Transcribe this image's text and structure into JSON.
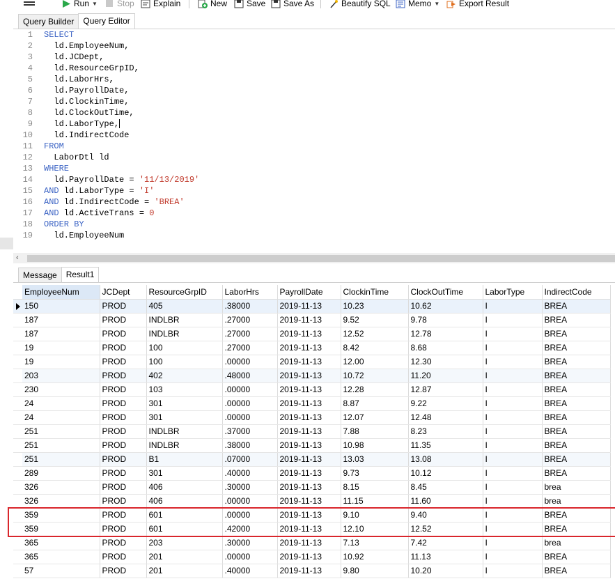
{
  "toolbar": {
    "run": "Run",
    "stop": "Stop",
    "explain": "Explain",
    "new": "New",
    "save": "Save",
    "save_as": "Save As",
    "beautify": "Beautify SQL",
    "memo": "Memo",
    "export": "Export Result"
  },
  "editor_tabs": [
    "Query Builder",
    "Query Editor"
  ],
  "sql_lines": [
    {
      "n": "1",
      "code": "SELECT"
    },
    {
      "n": "2",
      "code": "  ld.EmployeeNum,"
    },
    {
      "n": "3",
      "code": "  ld.JCDept,"
    },
    {
      "n": "4",
      "code": "  ld.ResourceGrpID,"
    },
    {
      "n": "5",
      "code": "  ld.LaborHrs,"
    },
    {
      "n": "6",
      "code": "  ld.PayrollDate,"
    },
    {
      "n": "7",
      "code": "  ld.ClockinTime,"
    },
    {
      "n": "8",
      "code": "  ld.ClockOutTime,"
    },
    {
      "n": "9",
      "code": "  ld.LaborType,"
    },
    {
      "n": "10",
      "code": "  ld.IndirectCode"
    },
    {
      "n": "11",
      "code": "FROM"
    },
    {
      "n": "12",
      "code": "  LaborDtl ld"
    },
    {
      "n": "13",
      "code": "WHERE"
    },
    {
      "n": "14",
      "code": "  ld.PayrollDate = '11/13/2019'"
    },
    {
      "n": "15",
      "code": "AND ld.LaborType = 'I'"
    },
    {
      "n": "16",
      "code": "AND ld.IndirectCode = 'BREA'"
    },
    {
      "n": "17",
      "code": "AND ld.ActiveTrans = 0"
    },
    {
      "n": "18",
      "code": "ORDER BY"
    },
    {
      "n": "19",
      "code": "  ld.EmployeeNum"
    }
  ],
  "result_tabs": [
    "Message",
    "Result1"
  ],
  "columns": [
    "EmployeeNum",
    "JCDept",
    "ResourceGrpID",
    "LaborHrs",
    "PayrollDate",
    "ClockinTime",
    "ClockOutTime",
    "LaborType",
    "IndirectCode"
  ],
  "rows": [
    [
      "150",
      "PROD",
      "405",
      ".38000",
      "2019-11-13",
      "10.23",
      "10.62",
      "I",
      "BREA"
    ],
    [
      "187",
      "PROD",
      "INDLBR",
      ".27000",
      "2019-11-13",
      "9.52",
      "9.78",
      "I",
      "BREA"
    ],
    [
      "187",
      "PROD",
      "INDLBR",
      ".27000",
      "2019-11-13",
      "12.52",
      "12.78",
      "I",
      "BREA"
    ],
    [
      "19",
      "PROD",
      "100",
      ".27000",
      "2019-11-13",
      "8.42",
      "8.68",
      "I",
      "BREA"
    ],
    [
      "19",
      "PROD",
      "100",
      ".00000",
      "2019-11-13",
      "12.00",
      "12.30",
      "I",
      "BREA"
    ],
    [
      "203",
      "PROD",
      "402",
      ".48000",
      "2019-11-13",
      "10.72",
      "11.20",
      "I",
      "BREA"
    ],
    [
      "230",
      "PROD",
      "103",
      ".00000",
      "2019-11-13",
      "12.28",
      "12.87",
      "I",
      "BREA"
    ],
    [
      "24",
      "PROD",
      "301",
      ".00000",
      "2019-11-13",
      "8.87",
      "9.22",
      "I",
      "BREA"
    ],
    [
      "24",
      "PROD",
      "301",
      ".00000",
      "2019-11-13",
      "12.07",
      "12.48",
      "I",
      "BREA"
    ],
    [
      "251",
      "PROD",
      "INDLBR",
      ".37000",
      "2019-11-13",
      "7.88",
      "8.23",
      "I",
      "BREA"
    ],
    [
      "251",
      "PROD",
      "INDLBR",
      ".38000",
      "2019-11-13",
      "10.98",
      "11.35",
      "I",
      "BREA"
    ],
    [
      "251",
      "PROD",
      "B1",
      ".07000",
      "2019-11-13",
      "13.03",
      "13.08",
      "I",
      "BREA"
    ],
    [
      "289",
      "PROD",
      "301",
      ".40000",
      "2019-11-13",
      "9.73",
      "10.12",
      "I",
      "BREA"
    ],
    [
      "326",
      "PROD",
      "406",
      ".30000",
      "2019-11-13",
      "8.15",
      "8.45",
      "I",
      "brea"
    ],
    [
      "326",
      "PROD",
      "406",
      ".00000",
      "2019-11-13",
      "11.15",
      "11.60",
      "I",
      "brea"
    ],
    [
      "359",
      "PROD",
      "601",
      ".00000",
      "2019-11-13",
      "9.10",
      "9.40",
      "I",
      "BREA"
    ],
    [
      "359",
      "PROD",
      "601",
      ".42000",
      "2019-11-13",
      "12.10",
      "12.52",
      "I",
      "BREA"
    ],
    [
      "365",
      "PROD",
      "203",
      ".30000",
      "2019-11-13",
      "7.13",
      "7.42",
      "I",
      "brea"
    ],
    [
      "365",
      "PROD",
      "201",
      ".00000",
      "2019-11-13",
      "10.92",
      "11.13",
      "I",
      "BREA"
    ],
    [
      "57",
      "PROD",
      "201",
      ".40000",
      "2019-11-13",
      "9.80",
      "10.20",
      "I",
      "BREA"
    ]
  ],
  "colors": {
    "keyword": "#3b63c4",
    "string": "#c0392b",
    "highlight": "#d9262c",
    "sorted_header": "#dce8f6"
  }
}
